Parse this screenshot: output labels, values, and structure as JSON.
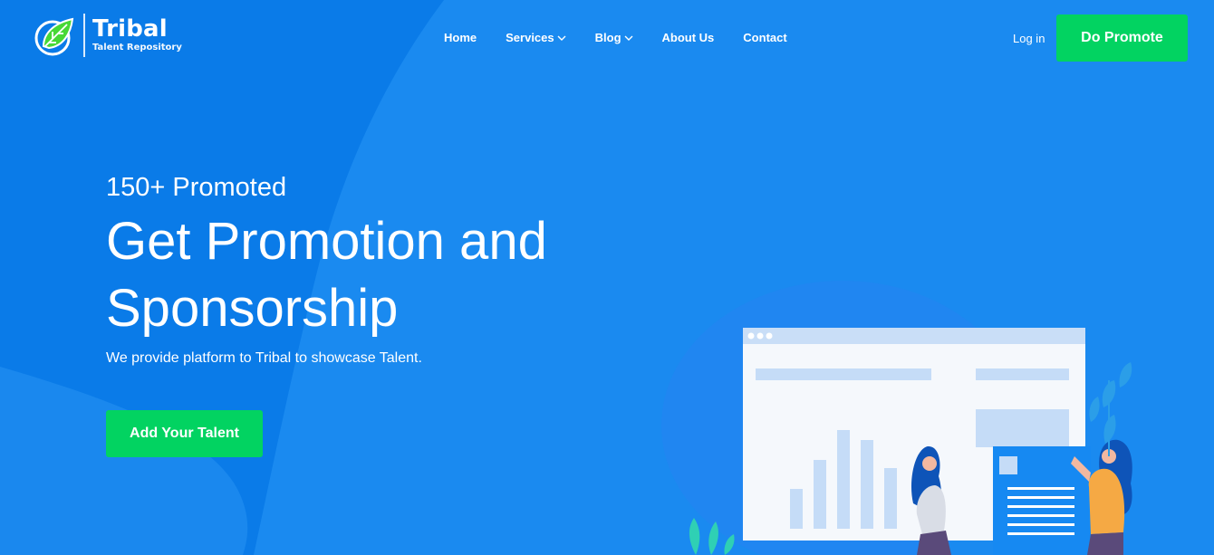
{
  "brand": {
    "name": "Tribal",
    "tagline": "Talent Repository",
    "logo_icon": "leaf-icon"
  },
  "nav": {
    "items": [
      {
        "label": "Home",
        "has_dropdown": false
      },
      {
        "label": "Services",
        "has_dropdown": true
      },
      {
        "label": "Blog",
        "has_dropdown": true
      },
      {
        "label": "About Us",
        "has_dropdown": false
      },
      {
        "label": "Contact",
        "has_dropdown": false
      }
    ]
  },
  "header": {
    "login_label": "Log in",
    "cta_label": "Do Promote"
  },
  "hero": {
    "kicker": "150+ Promoted",
    "headline": "Get Promotion and Sponsorship",
    "subtitle": "We provide platform to Tribal to showcase Talent.",
    "cta_label": "Add Your Talent"
  },
  "colors": {
    "background": "#0a7be8",
    "accent_green": "#02d361",
    "text": "#ffffff"
  }
}
